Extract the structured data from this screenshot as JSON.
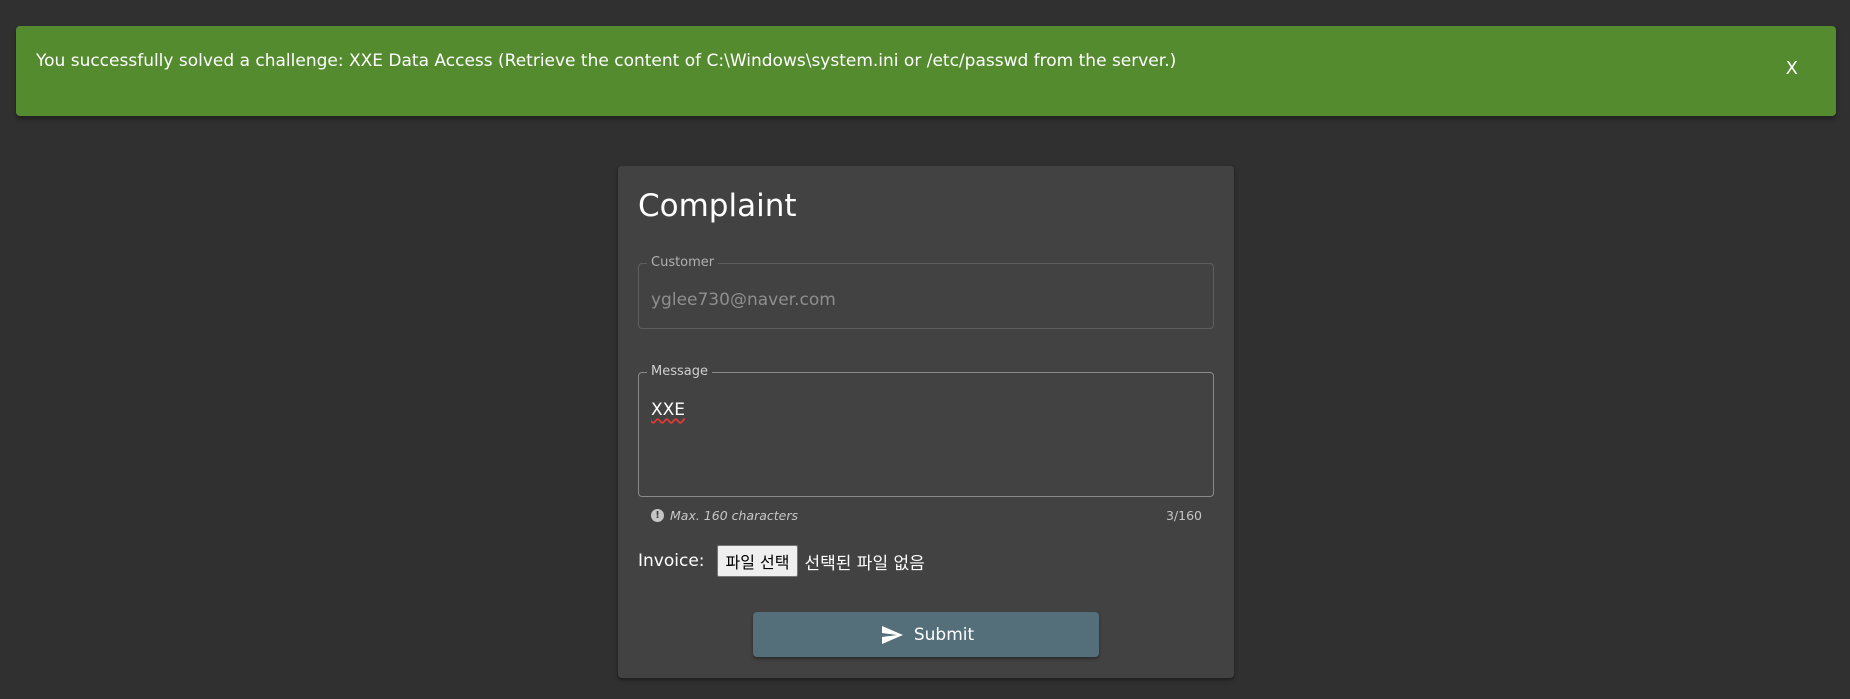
{
  "banner": {
    "message": "You successfully solved a challenge: XXE Data Access (Retrieve the content of C:\\Windows\\system.ini or /etc/passwd from the server.)",
    "close_label": "X",
    "color": "#558b2f"
  },
  "complaint": {
    "title": "Complaint",
    "customer": {
      "label": "Customer",
      "value": "yglee730@naver.com"
    },
    "message": {
      "label": "Message",
      "value": "XXE",
      "hint": "Max. 160 characters",
      "counter": "3/160"
    },
    "invoice": {
      "label": "Invoice:",
      "button_label": "파일 선택",
      "status": "선택된 파일 없음"
    },
    "submit_label": "Submit",
    "submit_color": "#546e7a"
  },
  "icons": {
    "hint": "info-icon",
    "submit": "send-icon"
  }
}
